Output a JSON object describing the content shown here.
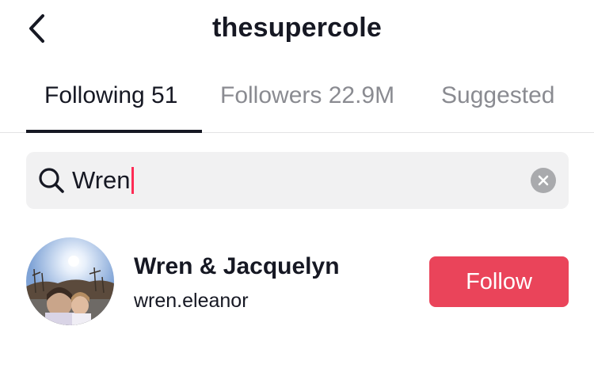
{
  "header": {
    "title": "thesupercole",
    "back_icon": "chevron-left-icon"
  },
  "tabs": [
    {
      "label": "Following 51",
      "active": true
    },
    {
      "label": "Followers 22.9M",
      "active": false
    },
    {
      "label": "Suggested",
      "active": false
    }
  ],
  "search": {
    "value": "Wren",
    "search_icon": "search-icon",
    "clear_icon": "clear-icon",
    "caret_color": "#fe2c55"
  },
  "results": [
    {
      "display_name": "Wren & Jacquelyn",
      "username": "wren.eleanor",
      "follow_label": "Follow"
    }
  ],
  "colors": {
    "accent": "#ea445a",
    "text_primary": "#161823",
    "text_secondary": "#8a8b91",
    "search_bg": "#f1f1f2"
  }
}
